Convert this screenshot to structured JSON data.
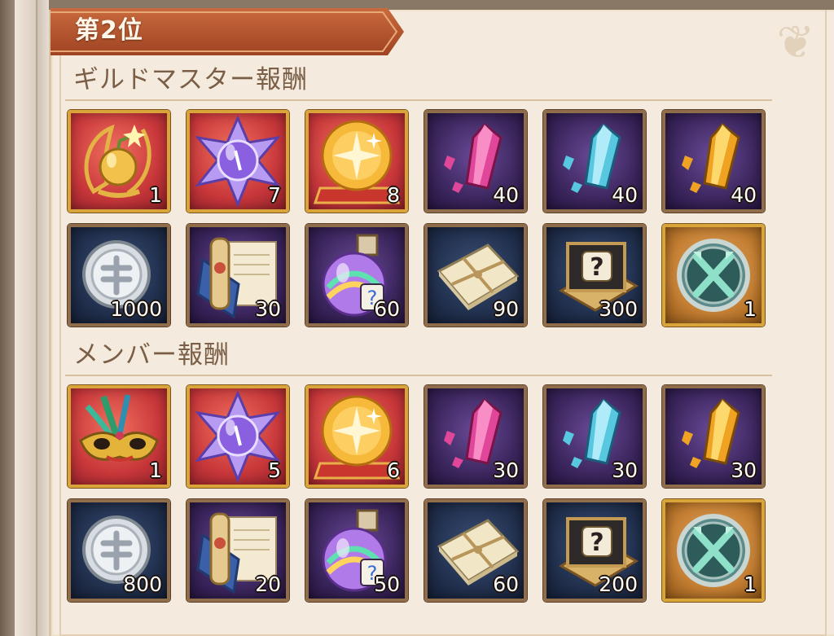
{
  "header": {
    "rank_title": "第2位"
  },
  "sections": [
    {
      "title": "ギルドマスター報酬",
      "rows": [
        [
          {
            "icon": "golden-apple-wreath-icon",
            "bg": "red",
            "quantity": "1"
          },
          {
            "icon": "purple-star-crystal-icon",
            "bg": "red",
            "quantity": "7"
          },
          {
            "icon": "golden-star-orb-icon",
            "bg": "red",
            "quantity": "8"
          },
          {
            "icon": "pink-crystal-shard-icon",
            "bg": "purple",
            "quantity": "40"
          },
          {
            "icon": "blue-crystal-shard-icon",
            "bg": "purple",
            "quantity": "40"
          },
          {
            "icon": "orange-crystal-shard-icon",
            "bg": "purple",
            "quantity": "40"
          }
        ],
        [
          {
            "icon": "silver-coin-icon",
            "bg": "navy",
            "quantity": "1000"
          },
          {
            "icon": "scroll-and-tome-icon",
            "bg": "purple",
            "quantity": "30"
          },
          {
            "icon": "rainbow-potion-icon",
            "bg": "purple",
            "quantity": "60"
          },
          {
            "icon": "bundled-papers-icon",
            "bg": "navy",
            "quantity": "90"
          },
          {
            "icon": "mystery-book-icon",
            "bg": "navy",
            "quantity": "300"
          },
          {
            "icon": "guild-emblem-icon",
            "bg": "orange",
            "quantity": "1"
          }
        ]
      ]
    },
    {
      "title": "メンバー報酬",
      "rows": [
        [
          {
            "icon": "feathered-masquerade-mask-icon",
            "bg": "red",
            "quantity": "1"
          },
          {
            "icon": "purple-star-crystal-icon",
            "bg": "red",
            "quantity": "5"
          },
          {
            "icon": "golden-star-orb-icon",
            "bg": "red",
            "quantity": "6"
          },
          {
            "icon": "pink-crystal-shard-icon",
            "bg": "purple",
            "quantity": "30"
          },
          {
            "icon": "blue-crystal-shard-icon",
            "bg": "purple",
            "quantity": "30"
          },
          {
            "icon": "orange-crystal-shard-icon",
            "bg": "purple",
            "quantity": "30"
          }
        ],
        [
          {
            "icon": "silver-coin-icon",
            "bg": "navy",
            "quantity": "800"
          },
          {
            "icon": "scroll-and-tome-icon",
            "bg": "purple",
            "quantity": "20"
          },
          {
            "icon": "rainbow-potion-icon",
            "bg": "purple",
            "quantity": "50"
          },
          {
            "icon": "bundled-papers-icon",
            "bg": "navy",
            "quantity": "60"
          },
          {
            "icon": "mystery-book-icon",
            "bg": "navy",
            "quantity": "200"
          },
          {
            "icon": "guild-emblem-icon",
            "bg": "orange",
            "quantity": "1"
          }
        ]
      ]
    }
  ],
  "colors": {
    "banner": "#b5552f",
    "panel": "#f4ebde",
    "section_text": "#7a5e46",
    "tile_border": "#8f6d4a",
    "tile_border_gold": "#d9a43a"
  }
}
